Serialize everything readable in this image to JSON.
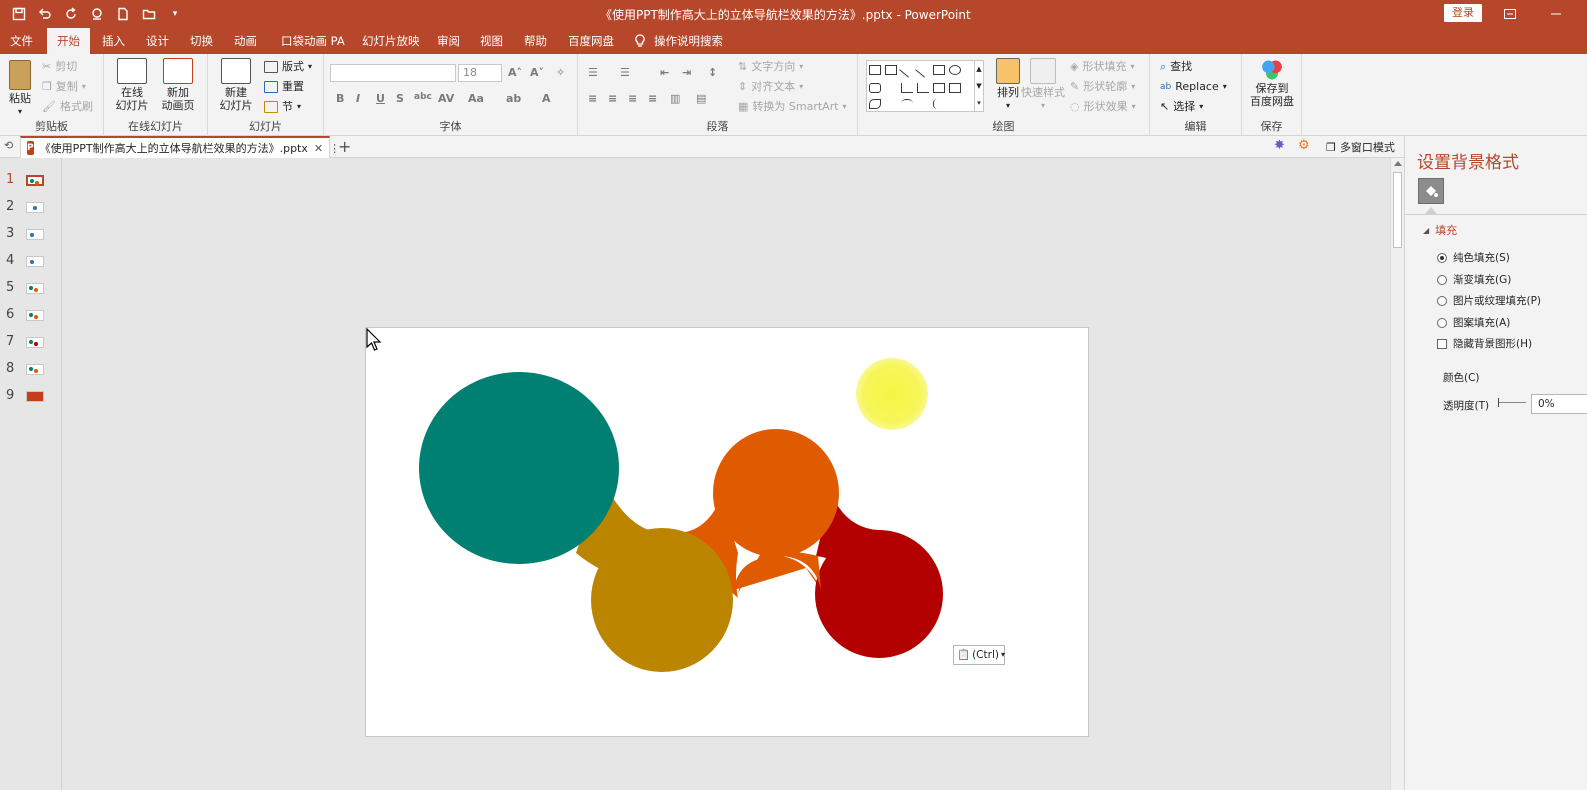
{
  "window": {
    "title": "《使用PPT制作高大上的立体导航栏效果的方法》.pptx  -  PowerPoint",
    "login_label": "登录"
  },
  "ribbon_tabs": [
    "文件",
    "开始",
    "插入",
    "设计",
    "切换",
    "动画",
    "口袋动画 PA",
    "幻灯片放映",
    "审阅",
    "视图",
    "帮助",
    "百度网盘"
  ],
  "active_tab": "开始",
  "tell_me": "操作说明搜索",
  "ribbon": {
    "clipboard": {
      "label": "剪贴板",
      "paste": "粘贴",
      "cut": "剪切",
      "copy": "复制",
      "format_painter": "格式刷"
    },
    "online_slides": {
      "label": "在线幻灯片",
      "online": "在线\n幻灯片",
      "new_anim": "新加\n动画页"
    },
    "slides": {
      "label": "幻灯片",
      "new_slide": "新建\n幻灯片",
      "layout": "版式",
      "reset": "重置",
      "section": "节"
    },
    "font": {
      "label": "字体",
      "font_name": "",
      "font_size": "18"
    },
    "paragraph": {
      "label": "段落",
      "text_direction": "文字方向",
      "align_text": "对齐文本",
      "smartart": "转换为 SmartArt"
    },
    "drawing": {
      "label": "绘图",
      "arrange": "排列",
      "quick_styles": "快速样式",
      "shape_fill": "形状填充",
      "shape_outline": "形状轮廓",
      "shape_effects": "形状效果"
    },
    "editing": {
      "label": "编辑",
      "find": "查找",
      "replace": "Replace",
      "select": "选择"
    },
    "save": {
      "label": "保存",
      "save_baidu": "保存到\n百度网盘"
    }
  },
  "doc_tab": {
    "name": "《使用PPT制作高大上的立体导航栏效果的方法》.pptx",
    "multi_window": "多窗口模式"
  },
  "thumbnails": [
    "1",
    "2",
    "3",
    "4",
    "5",
    "6",
    "7",
    "8",
    "9"
  ],
  "active_slide": 1,
  "slide": {
    "circle_colors": [
      "#007f73",
      "#bb8500",
      "#e05a00",
      "#b30000"
    ],
    "highlight_color": "#f5f546",
    "paste_options": "(Ctrl)"
  },
  "format_pane": {
    "title": "设置背景格式",
    "section": "填充",
    "options": [
      {
        "label": "纯色填充(S)",
        "selected": true
      },
      {
        "label": "渐变填充(G)",
        "selected": false
      },
      {
        "label": "图片或纹理填充(P)",
        "selected": false
      },
      {
        "label": "图案填充(A)",
        "selected": false
      }
    ],
    "hide_bg": "隐藏背景图形(H)",
    "color_label": "颜色(C)",
    "transparency_label": "透明度(T)",
    "transparency_value": "0%"
  }
}
